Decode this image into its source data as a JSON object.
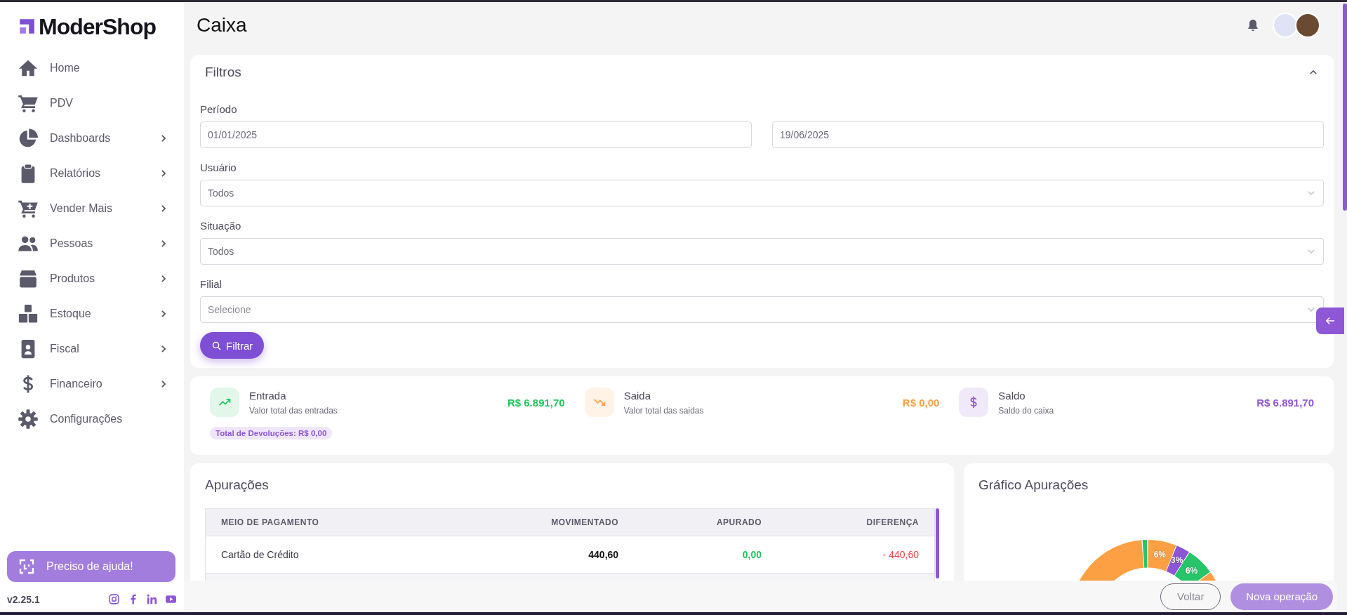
{
  "brand": {
    "name": "ModerShop"
  },
  "sidebar": {
    "items": [
      {
        "label": "Home",
        "expandable": false
      },
      {
        "label": "PDV",
        "expandable": false
      },
      {
        "label": "Dashboards",
        "expandable": true
      },
      {
        "label": "Relatórios",
        "expandable": true
      },
      {
        "label": "Vender Mais",
        "expandable": true
      },
      {
        "label": "Pessoas",
        "expandable": true
      },
      {
        "label": "Produtos",
        "expandable": true
      },
      {
        "label": "Estoque",
        "expandable": true
      },
      {
        "label": "Fiscal",
        "expandable": true
      },
      {
        "label": "Financeiro",
        "expandable": true
      },
      {
        "label": "Configurações",
        "expandable": false
      }
    ],
    "help_button": "Preciso de ajuda!",
    "version": "v2.25.1"
  },
  "header": {
    "title": "Caixa"
  },
  "filters": {
    "title": "Filtros",
    "expanded": true,
    "fields": [
      {
        "label": "Período",
        "kind": "date_range",
        "values": [
          "01/01/2025",
          "19/06/2025"
        ]
      },
      {
        "label": "Usuário",
        "kind": "select",
        "value": "Todos"
      },
      {
        "label": "Situação",
        "kind": "select",
        "value": "Todos"
      },
      {
        "label": "Filial",
        "kind": "select",
        "placeholder": "Selecione"
      }
    ],
    "button": "Filtrar"
  },
  "summary": {
    "items": [
      {
        "title": "Entrada",
        "subtitle": "Valor total das entradas",
        "value": "R$ 6.891,70",
        "color": "#22c55e"
      },
      {
        "title": "Saida",
        "subtitle": "Valor total das saidas",
        "value": "R$ 0,00",
        "color": "#ff9f43"
      },
      {
        "title": "Saldo",
        "subtitle": "Saldo do caixa",
        "value": "R$ 6.891,70",
        "color": "#8e57d6"
      }
    ],
    "badge": "Total de Devoluções: R$ 0,00"
  },
  "apuracoes": {
    "title": "Apurações",
    "columns": [
      "MEIO DE PAGAMENTO",
      "MOVIMENTADO",
      "APURADO",
      "DIFERENÇA"
    ],
    "rows": [
      {
        "cells": [
          "Cartão de Crédito",
          "440,60",
          "0,00",
          "- 440,60"
        ]
      }
    ]
  },
  "chart": {
    "title": "Gráfico Apurações",
    "labels": [
      "6%",
      "3%",
      "6%"
    ]
  },
  "footer": {
    "buttons": [
      {
        "label": "Voltar",
        "kind": "outline"
      },
      {
        "label": "Nova operação",
        "kind": "primary"
      }
    ]
  }
}
